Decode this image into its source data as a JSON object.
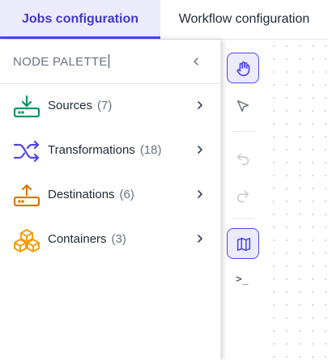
{
  "tabs": [
    {
      "label": "Jobs configuration",
      "active": true
    },
    {
      "label": "Workflow configuration",
      "active": false
    }
  ],
  "palette": {
    "title": "NODE PALETTE",
    "items": [
      {
        "label": "Sources",
        "count": "(7)",
        "icon": "sources-download-tray-icon",
        "color": "#059669"
      },
      {
        "label": "Transformations",
        "count": "(18)",
        "icon": "shuffle-icon",
        "color": "#4f46e5"
      },
      {
        "label": "Destinations",
        "count": "(6)",
        "icon": "destinations-upload-tray-icon",
        "color": "#d97706"
      },
      {
        "label": "Containers",
        "count": "(3)",
        "icon": "boxes-stack-icon",
        "color": "#f59e0b"
      }
    ]
  },
  "toolbar": {
    "items": [
      "hand-pan-icon",
      "pointer-select-icon",
      "undo-icon",
      "redo-icon",
      "map-icon",
      "terminal-icon"
    ],
    "terminal_glyph": ">_",
    "accent": "#4f46e5"
  }
}
